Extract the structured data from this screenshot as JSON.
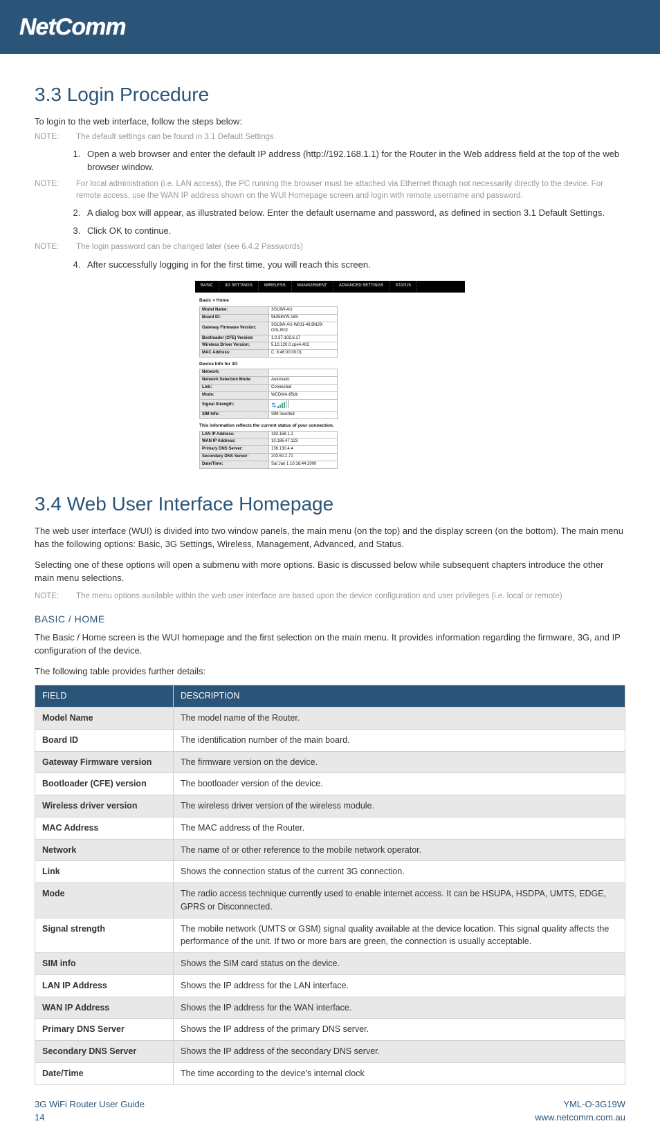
{
  "brand": "NetComm",
  "sections": {
    "login": {
      "heading": "3.3 Login Procedure",
      "intro": "To login to the web interface, follow the steps below:",
      "note1_label": "NOTE:",
      "note1_text": "The default settings can be found in 3.1 Default Settings",
      "step1": "Open a web browser and enter the default IP address (http://192.168.1.1) for the Router in the Web address field at the top of the web browser window.",
      "note2_label": "NOTE:",
      "note2_text": "For local administration (i.e. LAN access), the PC running the browser must be attached via Ethernet though not necessarily directly to the device. For remote access, use the WAN IP address shown on the WUI Homepage screen and login with remote username and password.",
      "step2": "A dialog box will appear, as illustrated below. Enter the default username and password, as defined in section 3.1 Default Settings.",
      "step3": "Click OK to continue.",
      "note3_label": "NOTE:",
      "note3_text": "The login password can be changed later (see 6.4.2 Passwords)",
      "step4": "After successfully logging in for the first time, you will reach this screen."
    },
    "wui": {
      "heading": "3.4 Web User Interface Homepage",
      "para1": "The web user interface (WUI) is divided into two window panels, the main menu (on the top) and the display screen (on the bottom). The main menu has the following options: Basic, 3G Settings, Wireless, Management, Advanced, and Status.",
      "para2": "Selecting one of these options will open a submenu with more options. Basic is discussed below while subsequent chapters introduce the other main menu selections.",
      "note_label": "NOTE:",
      "note_text": "The menu options available within the web user interface are based upon the device configuration and user privileges (i.e. local or remote)",
      "basic_heading": "BASIC / HOME",
      "basic_para": "The Basic / Home screen is the WUI homepage and the first selection on the main menu. It provides information regarding the firmware, 3G, and IP configuration of the device.",
      "table_intro": "The following table provides further details:"
    }
  },
  "screenshot": {
    "tabs": [
      "BASIC",
      "3G SETTINGS",
      "WIRELESS",
      "MANAGEMENT",
      "ADVANCED SETTINGS",
      "STATUS"
    ],
    "crumb": "Basic > Home",
    "block1": [
      {
        "k": "Model Name:",
        "v": "3G19W-AU"
      },
      {
        "k": "Board ID:",
        "v": "96358VW-16S"
      },
      {
        "k": "Gateway Firmware Version:",
        "v": "3G19W-AU-W011-48.BN29-O01.R02"
      },
      {
        "k": "Bootloader (CFE) Version:",
        "v": "1.0.37-102.6.17"
      },
      {
        "k": "Wireless Driver Version:",
        "v": "5.10.120.0.cpe4.402"
      },
      {
        "k": "MAC Address:",
        "v": "C: 8:46:00:00:01"
      }
    ],
    "sub1": "Device Info for 3G",
    "block2": [
      {
        "k": "Network:",
        "v": ""
      },
      {
        "k": "Network Selection Mode:",
        "v": "Automatic"
      },
      {
        "k": "Link:",
        "v": "Connected"
      },
      {
        "k": "Mode:",
        "v": "WCDMA-85db"
      },
      {
        "k": "Signal Strength:",
        "v": "signal"
      },
      {
        "k": "SIM Info:",
        "v": "SIM inserted"
      }
    ],
    "sub2": "This information reflects the current status of your connection.",
    "block3": [
      {
        "k": "LAN IP Address:",
        "v": "192.168.1.1"
      },
      {
        "k": "WAN IP Address:",
        "v": "10.186.47.123"
      },
      {
        "k": "Primary DNS Server:",
        "v": "136.130.4.4"
      },
      {
        "k": "Secondary DNS Server:",
        "v": "203.50.2.71"
      },
      {
        "k": "Date/Time:",
        "v": "Sat Jan 1 10:16:44 2000"
      }
    ]
  },
  "field_table": {
    "headers": [
      "FIELD",
      "DESCRIPTION"
    ],
    "rows": [
      {
        "f": "Model Name",
        "d": "The model name of the Router.",
        "alt": true
      },
      {
        "f": "Board ID",
        "d": "The identification number of the main board.",
        "alt": false
      },
      {
        "f": "Gateway Firmware version",
        "d": "The firmware version on the device.",
        "alt": true
      },
      {
        "f": "Bootloader (CFE) version",
        "d": "The bootloader version of the device.",
        "alt": false
      },
      {
        "f": "Wireless driver version",
        "d": "The wireless driver version of the wireless module.",
        "alt": true
      },
      {
        "f": "MAC Address",
        "d": "The MAC address of the Router.",
        "alt": false
      },
      {
        "f": "Network",
        "d": "The name of or other reference to the mobile network operator.",
        "alt": true
      },
      {
        "f": "Link",
        "d": "Shows the connection status of the current 3G connection.",
        "alt": false
      },
      {
        "f": "Mode",
        "d": "The radio access technique currently used to enable internet access. It can be HSUPA, HSDPA, UMTS, EDGE, GPRS or Disconnected.",
        "alt": true
      },
      {
        "f": "Signal strength",
        "d": "The mobile network (UMTS or GSM) signal quality available at the device location. This signal quality affects the performance of the unit. If two or more bars are green, the connection is usually acceptable.",
        "alt": false
      },
      {
        "f": "SIM info",
        "d": "Shows the SIM card status on the device.",
        "alt": true
      },
      {
        "f": "LAN IP Address",
        "d": "Shows the IP address for the LAN interface.",
        "alt": false
      },
      {
        "f": "WAN IP Address",
        "d": "Shows the IP address for the WAN interface.",
        "alt": true
      },
      {
        "f": "Primary DNS Server",
        "d": "Shows the IP address of the primary DNS server.",
        "alt": false
      },
      {
        "f": "Secondary DNS Server",
        "d": "Shows the IP address of the secondary DNS server.",
        "alt": true
      },
      {
        "f": "Date/Time",
        "d": "The time according to the device's internal clock",
        "alt": false
      }
    ]
  },
  "footer": {
    "left1": "3G WiFi Router User Guide",
    "left2": "14",
    "right1": "YML-O-3G19W",
    "right2": "www.netcomm.com.au"
  }
}
